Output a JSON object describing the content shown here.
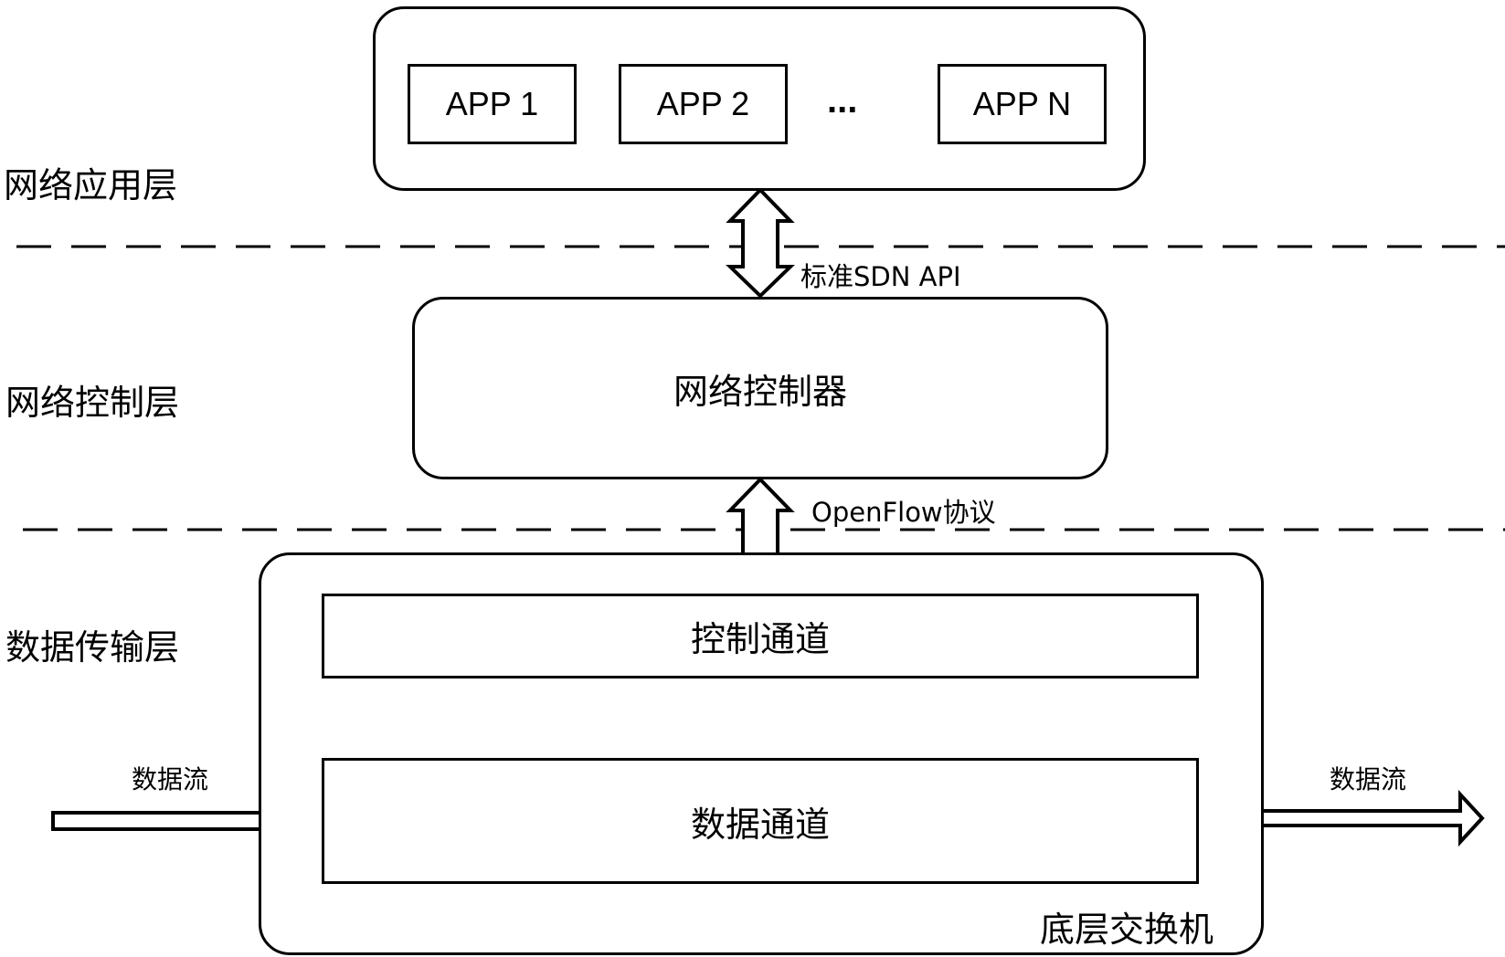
{
  "layers": {
    "application": "网络应用层",
    "control": "网络控制层",
    "data": "数据传输层"
  },
  "apps": [
    "APP 1",
    "APP 2",
    "...",
    "APP N"
  ],
  "interfaces": {
    "northbound": "标准SDN API",
    "southbound": "OpenFlow协议"
  },
  "controller": "网络控制器",
  "switch": {
    "label": "底层交换机",
    "control_channel": "控制通道",
    "data_channel": "数据通道"
  },
  "flows": {
    "input": "数据流",
    "output": "数据流"
  }
}
